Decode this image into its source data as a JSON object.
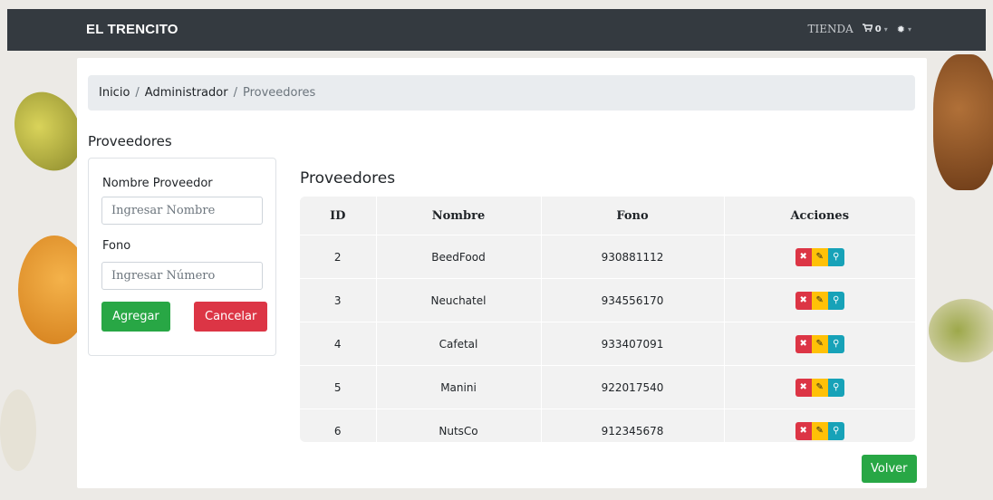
{
  "navbar": {
    "brand": "EL TRENCITO",
    "store_label": "TIENDA",
    "cart_count": "0",
    "icons": [
      "cart-icon",
      "caret-down-icon",
      "gear-icon",
      "caret-down-icon"
    ]
  },
  "breadcrumb": {
    "items": [
      "Inicio",
      "Administrador",
      "Proveedores"
    ],
    "separator": "/"
  },
  "page_title": "Proveedores",
  "form": {
    "name_label": "Nombre Proveedor",
    "name_placeholder": "Ingresar Nombre",
    "phone_label": "Fono",
    "phone_placeholder": "Ingresar Número",
    "add_button": "Agregar",
    "cancel_button": "Cancelar"
  },
  "table": {
    "title": "Proveedores",
    "headers": [
      "ID",
      "Nombre",
      "Fono",
      "Acciones"
    ],
    "rows": [
      {
        "id": "2",
        "nombre": "BeedFood",
        "fono": "930881112"
      },
      {
        "id": "3",
        "nombre": "Neuchatel",
        "fono": "934556170"
      },
      {
        "id": "4",
        "nombre": "Cafetal",
        "fono": "933407091"
      },
      {
        "id": "5",
        "nombre": "Manini",
        "fono": "922017540"
      },
      {
        "id": "6",
        "nombre": "NutsCo",
        "fono": "912345678"
      }
    ],
    "action_icons": [
      "delete-icon",
      "edit-icon",
      "view-icon"
    ]
  },
  "back_button": "Volver",
  "colors": {
    "navbar": "#343a40",
    "success": "#28a745",
    "danger": "#dc3545",
    "warning": "#ffc107",
    "info": "#17a2b8"
  }
}
